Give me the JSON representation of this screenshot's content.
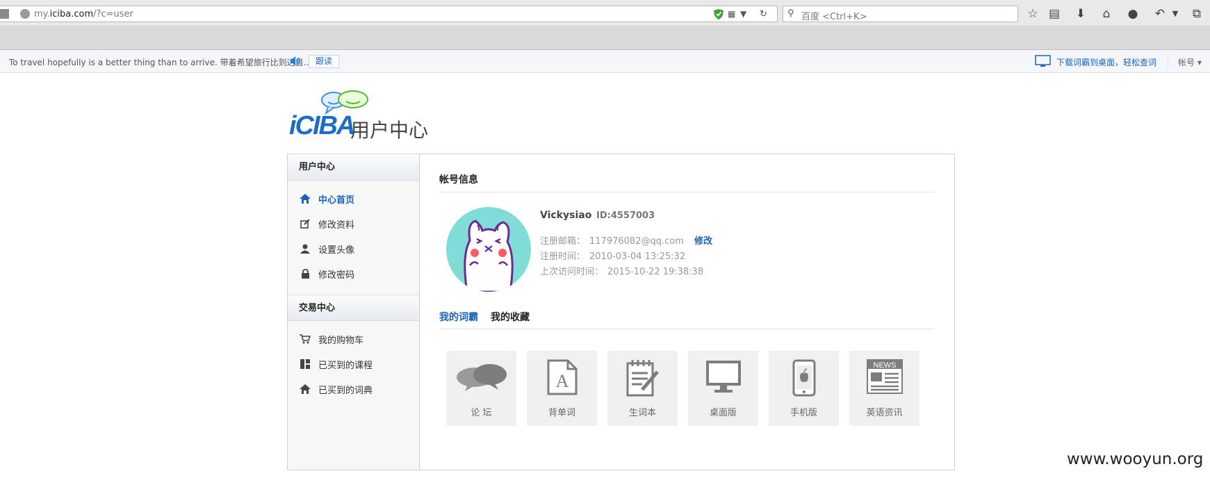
{
  "browser": {
    "url_prefix": "my.",
    "url_domain": "iciba.com",
    "url_path": "/?c=user",
    "search_placeholder": "百度 <Ctrl+K>"
  },
  "topbar": {
    "sentence": "To travel hopefully is a better thing than to arrive. 带着希望旅行比到达目...",
    "follow_label": "跟读",
    "download_text": "下载词霸到桌面，轻松查词",
    "account_label": "帐号 ▾"
  },
  "logo": {
    "brand": "iCIBA",
    "subtitle": "用户中心"
  },
  "sidebar": {
    "user_section": {
      "title": "用户中心",
      "items": [
        {
          "label": "中心首页",
          "icon": "home-icon",
          "active": true
        },
        {
          "label": "修改资料",
          "icon": "edit-icon"
        },
        {
          "label": "设置头像",
          "icon": "user-icon"
        },
        {
          "label": "修改密码",
          "icon": "lock-icon"
        }
      ]
    },
    "trade_section": {
      "title": "交易中心",
      "items": [
        {
          "label": "我的购物车",
          "icon": "cart-icon"
        },
        {
          "label": "已买到的课程",
          "icon": "grid-icon"
        },
        {
          "label": "已买到的词典",
          "icon": "home-icon"
        }
      ]
    }
  },
  "account": {
    "section_title": "帐号信息",
    "username": "Vickysiao",
    "user_id": "ID:4557003",
    "email_label": "注册邮箱：",
    "email": "117976082@qq.com",
    "edit_label": "修改",
    "reg_time_label": "注册时间：",
    "reg_time": "2010-03-04 13:25:32",
    "last_visit_label": "上次访问时间：",
    "last_visit": "2015-10-22 19:38:38"
  },
  "tabs": [
    {
      "label": "我的词霸",
      "active": true
    },
    {
      "label": "我的收藏",
      "active": false
    }
  ],
  "tiles": [
    {
      "label": "论 坛",
      "icon": "chat-bubbles-icon"
    },
    {
      "label": "背单词",
      "icon": "document-a-icon"
    },
    {
      "label": "生词本",
      "icon": "notepad-icon"
    },
    {
      "label": "桌面版",
      "icon": "monitor-icon"
    },
    {
      "label": "手机版",
      "icon": "phone-icon"
    },
    {
      "label": "英语资讯",
      "icon": "news-icon"
    }
  ],
  "watermark": "www.wooyun.org",
  "colors": {
    "link_blue": "#1a64b8",
    "logo_blue": "#1c6cc9",
    "avatar_bg": "#7fdcd6",
    "tile_bg": "#f0f0f0"
  }
}
